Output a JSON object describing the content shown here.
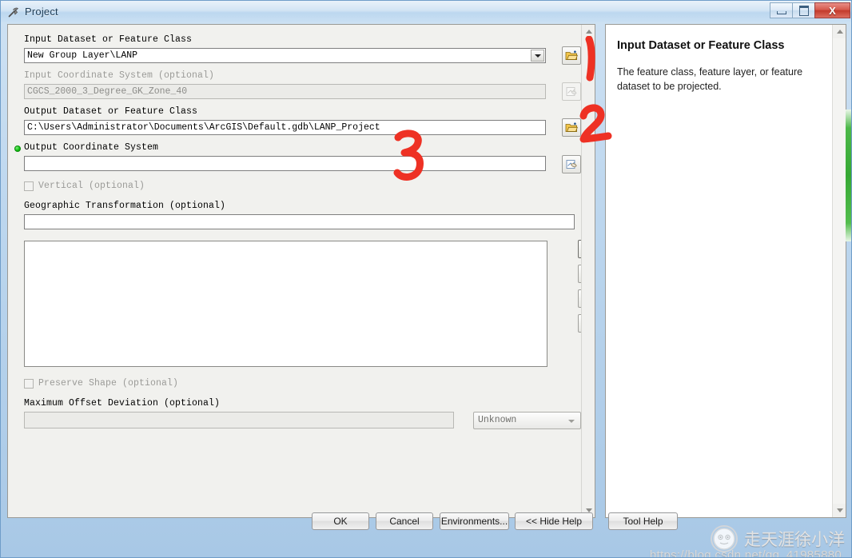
{
  "window": {
    "title": "Project",
    "icon": "hammer-icon",
    "controls": {
      "minimize": "–",
      "maximize": "□",
      "close": "X"
    }
  },
  "form": {
    "input_dataset": {
      "label": "Input Dataset or Feature Class",
      "value": "New Group Layer\\LANP",
      "browse_icon": "folder-open-icon"
    },
    "input_coordinate_system": {
      "label": "Input Coordinate System  (optional)",
      "value": "CGCS_2000_3_Degree_GK_Zone_40",
      "browse_icon": "globe-page-icon",
      "disabled": true
    },
    "output_dataset": {
      "label": "Output Dataset or Feature Class",
      "value": "C:\\Users\\Administrator\\Documents\\ArcGIS\\Default.gdb\\LANP_Project",
      "browse_icon": "folder-open-icon"
    },
    "output_coordinate_system": {
      "label": "Output Coordinate System",
      "value": "",
      "browse_icon": "globe-page-icon",
      "required": true
    },
    "vertical": {
      "label": "Vertical  (optional)",
      "checked": false,
      "disabled": true
    },
    "geographic_transformation": {
      "label": "Geographic Transformation  (optional)",
      "value": ""
    },
    "list_side_buttons": [
      {
        "name": "add-button",
        "icon": "plus-icon",
        "enabled": true
      },
      {
        "name": "remove-button",
        "icon": "x-icon",
        "enabled": false
      },
      {
        "name": "move-up-button",
        "icon": "arrow-up-icon",
        "enabled": false
      },
      {
        "name": "move-down-button",
        "icon": "arrow-down-icon",
        "enabled": false
      }
    ],
    "preserve_shape": {
      "label": "Preserve Shape  (optional)",
      "checked": false,
      "disabled": true
    },
    "maximum_offset_deviation": {
      "label": "Maximum Offset Deviation  (optional)",
      "value": "",
      "unit": "Unknown"
    }
  },
  "help": {
    "title": "Input Dataset or Feature Class",
    "body": "The feature class, feature layer, or feature dataset to be projected."
  },
  "footer": {
    "ok": "OK",
    "cancel": "Cancel",
    "environments": "Environments...",
    "hide_help": "<< Hide Help",
    "tool_help": "Tool Help"
  },
  "annotations": [
    {
      "name": "annotation-1",
      "text": "1"
    },
    {
      "name": "annotation-2",
      "text": "2"
    },
    {
      "name": "annotation-3",
      "text": "3"
    }
  ],
  "watermark": {
    "name": "走天涯徐小洋",
    "url": "https://blog.csdn.net/qq_41985880"
  },
  "colors": {
    "accent_red": "#ee3124",
    "required_green": "#16bf16",
    "titlebar_blue": "#bcd7ef",
    "close_red": "#c33a2c"
  }
}
